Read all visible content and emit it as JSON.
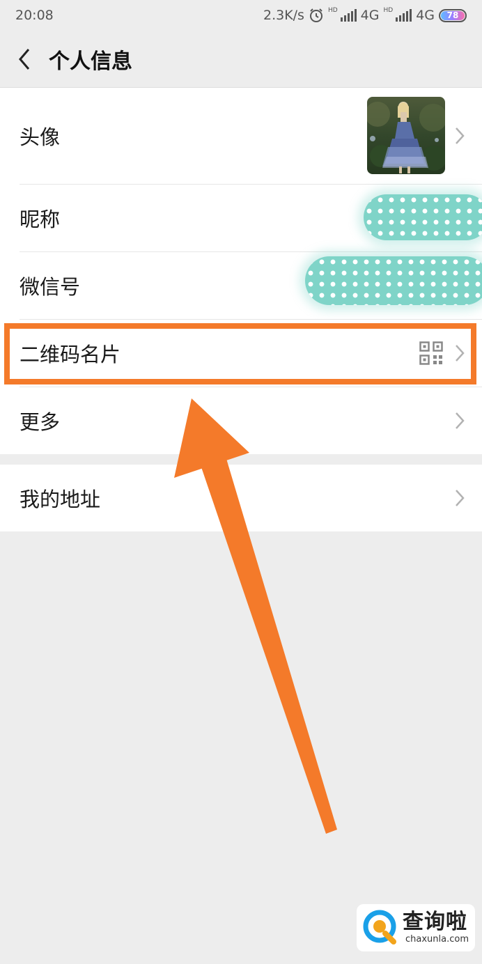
{
  "status_bar": {
    "time": "20:08",
    "net_speed": "2.3K/s",
    "network_1": "4G",
    "network_2": "4G",
    "hd_label_1": "HD",
    "hd_label_2": "HD",
    "battery": "78"
  },
  "nav": {
    "title": "个人信息"
  },
  "rows": {
    "avatar": "头像",
    "nickname": "昵称",
    "wechat_id": "微信号",
    "qr_card": "二维码名片",
    "more": "更多",
    "address": "我的地址"
  },
  "annotation": {
    "highlight_color": "#f47a2a",
    "arrow_color": "#f47a2a"
  },
  "watermark": {
    "name": "查询啦",
    "domain": "chaxunla.com"
  },
  "colors": {
    "background": "#ededed",
    "card": "#ffffff",
    "text": "#1a1a1a",
    "chevron": "#b2b2b2",
    "mask": "#7fd4c8"
  }
}
